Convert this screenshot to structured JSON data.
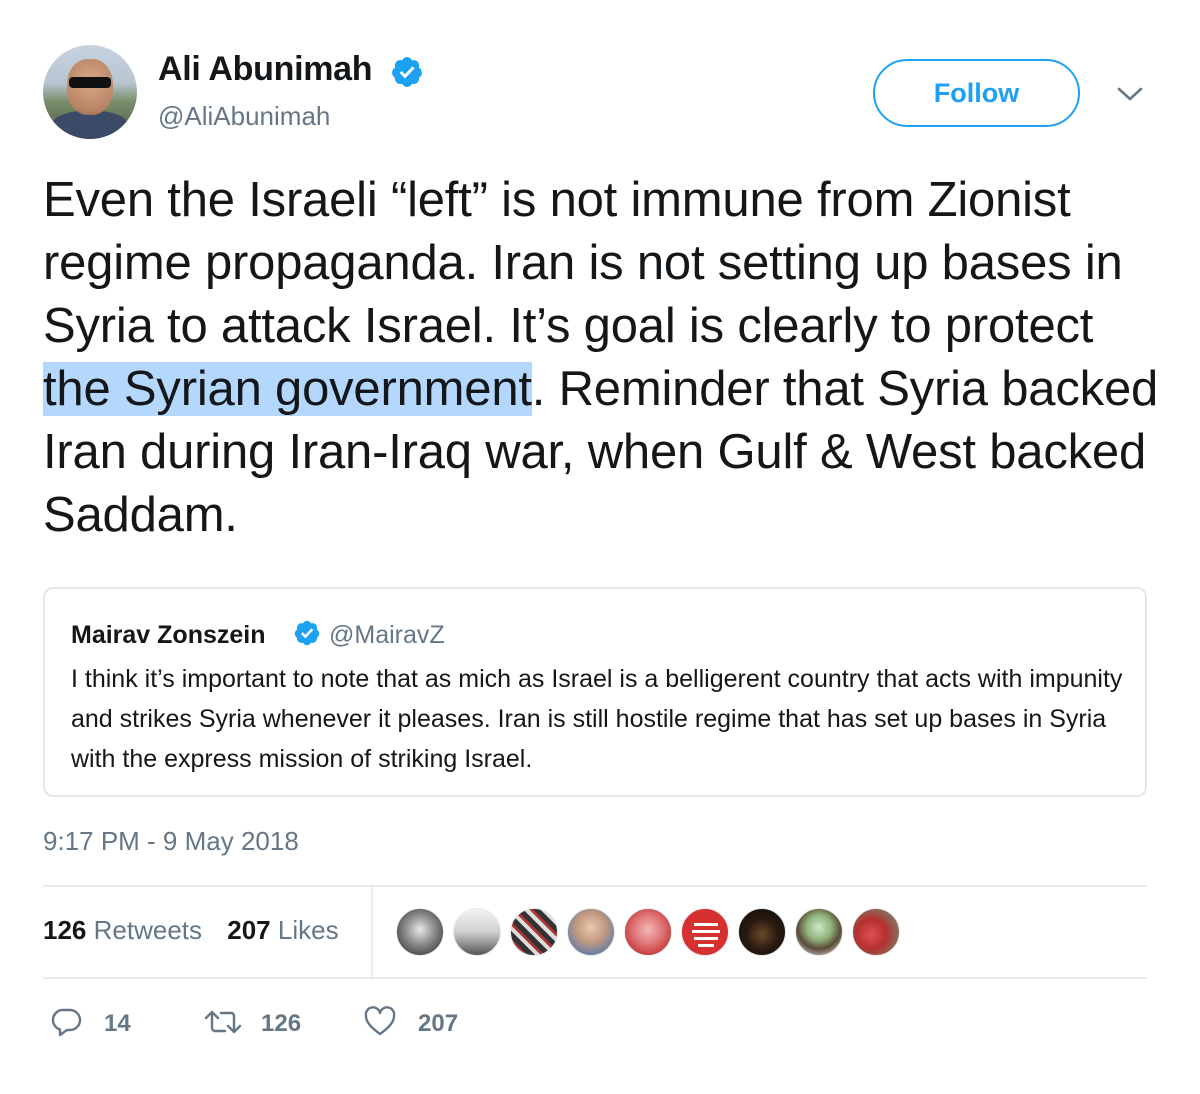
{
  "author": {
    "display_name": "Ali Abunimah",
    "handle": "@AliAbunimah",
    "verified": true
  },
  "follow_label": "Follow",
  "tweet": {
    "text_before": "Even the Israeli “left” is not immune from Zionist regime propaganda. Iran is not setting up bases in Syria to attack Israel. It’s goal is clearly to protect ",
    "text_highlight": "the Syrian government",
    "text_after": ". Reminder that Syria backed Iran during Iran-Iraq war, when Gulf & West backed Saddam."
  },
  "quoted_tweet": {
    "display_name": "Mairav Zonszein",
    "handle": "@MairavZ",
    "verified": true,
    "text": "I think it’s important to note that as mich as Israel is a belligerent country that acts with impunity and strikes Syria whenever it pleases. Iran is still hostile regime that has set up bases in Syria with the express mission of striking Israel."
  },
  "timestamp": "9:17 PM - 9 May 2018",
  "stats": {
    "retweets_count": "126",
    "retweets_label": "Retweets",
    "likes_count": "207",
    "likes_label": "Likes"
  },
  "actions": {
    "replies": "14",
    "retweets": "126",
    "likes": "207"
  },
  "colors": {
    "accent": "#1da1f2",
    "secondary_text": "#657786",
    "highlight": "#b3d7fd",
    "border": "#e1e8ed"
  },
  "liker_avatars": [
    "avatar-1",
    "avatar-2",
    "avatar-3",
    "avatar-4",
    "avatar-5",
    "avatar-6",
    "avatar-7",
    "avatar-8",
    "avatar-9"
  ]
}
